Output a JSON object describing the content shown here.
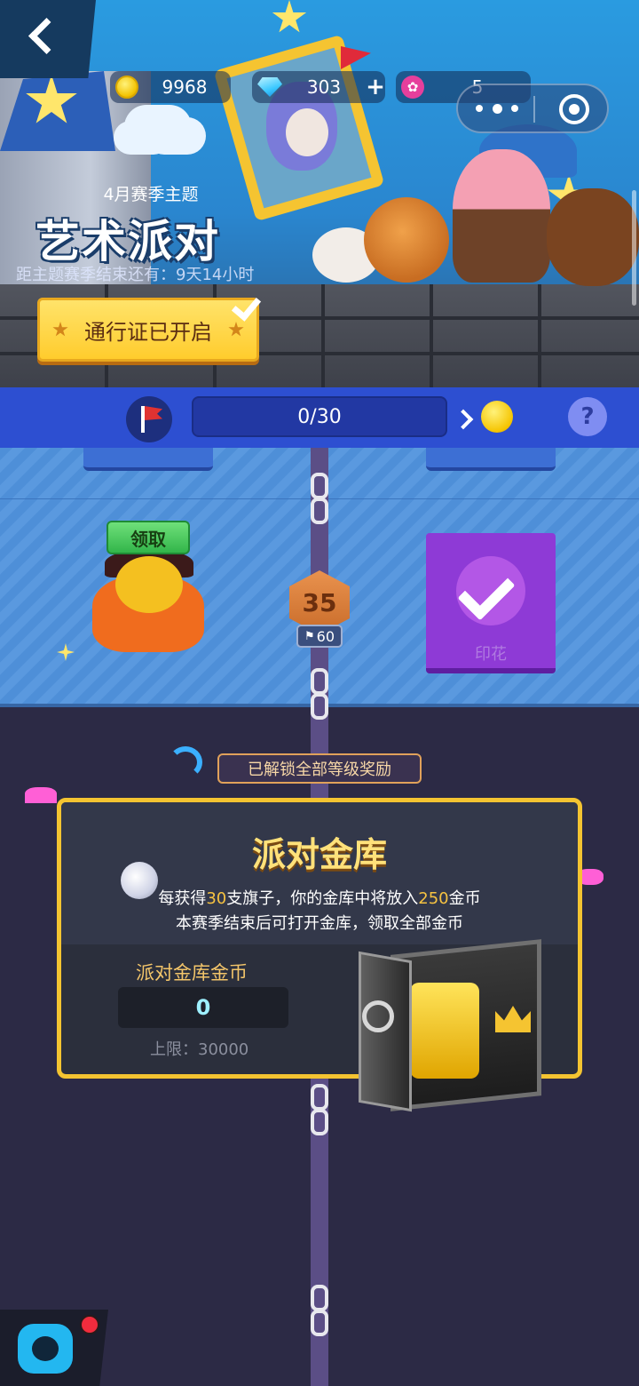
{
  "header": {
    "currencies": {
      "coins": "9968",
      "gems": "303",
      "gems_add": "+",
      "flowers": "5"
    }
  },
  "season": {
    "subtitle": "4月赛季主题",
    "title": "艺术派对",
    "countdown": "距主题赛季结束还有：9天14小时",
    "pass_button": "通行证已开启"
  },
  "progress": {
    "flags_text": "0/30",
    "help_label": "?"
  },
  "track": {
    "claim_button": "领取",
    "level": "35",
    "level_requirement": "60",
    "stamp_label": "印花"
  },
  "vault": {
    "unlocked_tag": "已解锁全部等级奖励",
    "title": "派对金库",
    "desc_line1_a": "每获得",
    "desc_line1_flags": "30",
    "desc_line1_b": "支旗子，你的金库中将放入",
    "desc_line1_coins": "250",
    "desc_line1_c": "金币",
    "desc_line2": "本赛季结束后可打开金库，领取全部金币",
    "coins_label": "派对金库金币",
    "coins_value": "0",
    "limit": "上限：30000"
  },
  "colors": {
    "progress_bar": "#2d4fd1",
    "vault_border": "#f4c431",
    "claim_green": "#32b54a",
    "stamp_purple": "#8e3ad6"
  },
  "icons": [
    "back-arrow-icon",
    "coin-icon",
    "gem-icon",
    "lotus-icon",
    "more-dots-icon",
    "close-circle-icon",
    "flag-icon",
    "chevron-right-icon",
    "help-icon",
    "check-icon",
    "robot-icon"
  ]
}
